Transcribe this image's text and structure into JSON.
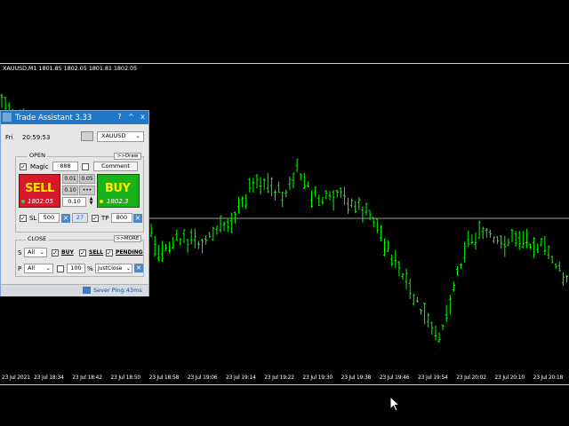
{
  "chart": {
    "symbol_info": "XAUUSD,M1  1801.85 1802.05 1801.81 1802.05",
    "time_labels": [
      "23 Jul 2021",
      "23 Jul 18:34",
      "23 Jul 18:42",
      "23 Jul 18:50",
      "23 Jul 18:58",
      "23 Jul 19:06",
      "23 Jul 19:14",
      "23 Jul 19:22",
      "23 Jul 19:30",
      "23 Jul 19:38",
      "23 Jul 19:46",
      "23 Jul 19:54",
      "23 Jul 20:02",
      "23 Jul 20:10",
      "23 Jul 20:18"
    ],
    "bar_color": "#00ff00",
    "bid_line_color": "#a0a0a0"
  },
  "panel": {
    "title": "Trade Assistant 3.33",
    "title_buttons": [
      "?",
      "^",
      "x"
    ],
    "day": "Fri",
    "time": "20:59:53",
    "symbol": "XAUUSD",
    "open_group": "OPEN",
    "draw_button": ">>Draw",
    "magic_label": "Magic",
    "magic_value": "888",
    "comment_button": "Comment",
    "sell_label": "SELL",
    "sell_price": "1802.05",
    "buy_label": "BUY",
    "buy_price": "1802.3",
    "lot_presets": [
      "0.01",
      "0.05",
      "0.10",
      "•••"
    ],
    "lot_value": "0.10",
    "sl_label": "SL",
    "sl_value": "500",
    "sl_points": "27",
    "tp_label": "TP",
    "tp_value": "800",
    "close_group": "CLOSE",
    "more_button": ">>MORE",
    "s_label": "S",
    "s_select": "All",
    "close_buy": "BUY",
    "close_sell": "SELL",
    "close_pending": "PENDING",
    "p_label": "P",
    "p_select": "All",
    "percent_value": "100",
    "percent_sign": "%",
    "close_mode": "JustClose",
    "server_ping": "Sever Ping:43ms"
  },
  "colors": {
    "sell_red": "#d7192b",
    "buy_green": "#1ab21a",
    "title_blue": "#1f78c8"
  }
}
